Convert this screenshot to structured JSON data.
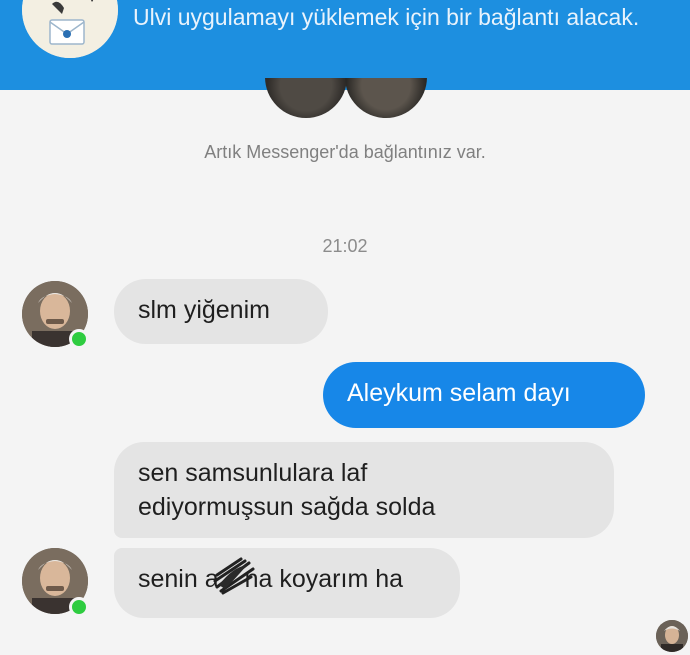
{
  "banner": {
    "text": "Ulvi uygulamayı yüklemek için bir bağlantı alacak."
  },
  "connection": {
    "text": "Artık Messenger'da bağlantınız var."
  },
  "conversation": {
    "timestamp": "21:02",
    "messages": [
      {
        "sender": "other",
        "text": "slm yiğenim"
      },
      {
        "sender": "me",
        "text": "Aleykum selam dayı"
      },
      {
        "sender": "other",
        "line1": "sen samsunlulara laf",
        "line2": "ediyormuşsun sağda solda"
      },
      {
        "sender": "other",
        "before": "senin a",
        "after": "na koyarım ha"
      }
    ]
  },
  "colors": {
    "banner_blue": "#1d8fe0",
    "outgoing_bubble": "#1787e8",
    "incoming_bubble": "#e4e4e4",
    "online": "#2ecc40"
  }
}
